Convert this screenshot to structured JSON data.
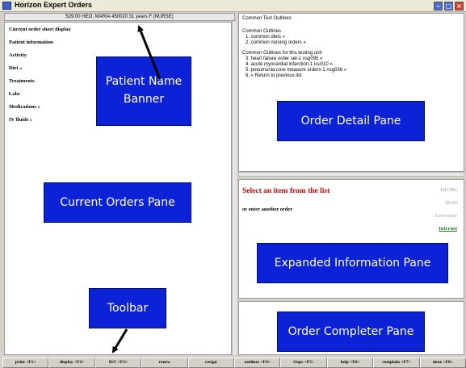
{
  "window": {
    "title": "Horizon Expert Orders",
    "controls": [
      "minimize-icon",
      "maximize-icon",
      "close-icon"
    ]
  },
  "banner": {
    "text": "529:00  HEO, MARIA  450020  31 years  F  (NURSE)"
  },
  "orders_pane": {
    "items": [
      "Current order sheet display",
      "Patient information",
      "Activity",
      "Diet »",
      "Treatments",
      "Labs",
      "Medications »",
      "IV fluids »"
    ]
  },
  "detail_pane": {
    "title": "Common Test Outlines",
    "common_heading": "Common Outlines",
    "common_items": [
      "1. common diets  »",
      "2. common nursing orders  »"
    ],
    "unit_heading": "Common Outlines for this testing unit",
    "unit_items": [
      "3. heart failure order set-1 nsg095  »",
      "4. acute myocardial infarction-1 icu010  »",
      "5. pneumonia core measure orders-1 nsg036  »",
      "6. « Return to previous list"
    ]
  },
  "expanded_pane": {
    "select_text": "Select an item from the list",
    "enter_text": "or enter another order",
    "hfor_label": "HFORx",
    "price": "$0.00",
    "less_label": "Less more",
    "internet_link": "Internet"
  },
  "toolbar": {
    "buttons": [
      "print <F1>",
      "display <F2>",
      "D/C <F3>",
      "renew",
      "cosign",
      "outlines <F4>",
      "Oops <F5>",
      "help <F6>",
      "complain <F7>",
      "done <F8>"
    ]
  },
  "annotations": {
    "banner_label": "Patient Name Banner",
    "orders_label": "Current Orders Pane",
    "detail_label": "Order Detail Pane",
    "expanded_label": "Expanded Information Pane",
    "toolbar_label": "Toolbar",
    "completer_label": "Order Completer Pane"
  },
  "colors": {
    "callout_bg": "#0b22d6",
    "select_text": "#e00000",
    "internet_link": "#208020",
    "chrome": "#d4d0c8"
  }
}
